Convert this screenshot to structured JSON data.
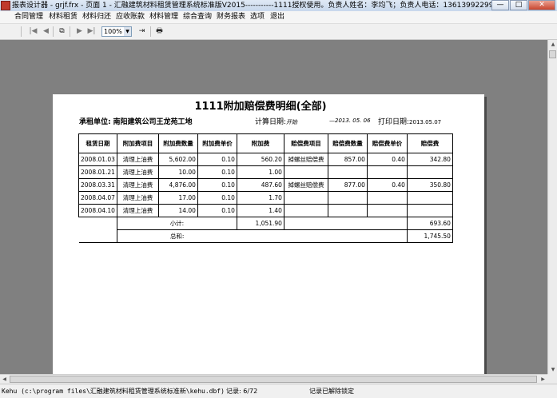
{
  "window": {
    "title": "报表设计器 - grjf.frx - 页面 1 - 汇融建筑材料租赁管理系统标准版V2015-----------1111授权使用。负责人姓名：李均飞；负责人电话：13613992299。",
    "minimize": "—",
    "maximize": "□",
    "close": "✕"
  },
  "menu": [
    "合同管理",
    "材料租赁",
    "材料归还",
    "应收账款",
    "材料管理",
    "综合查询",
    "财务报表",
    "选项",
    "退出"
  ],
  "toolbar": {
    "zoom": "100%",
    "icons": [
      "first-page-icon",
      "prev-page-icon",
      "copy-pages-icon",
      "next-page-icon",
      "last-page-icon",
      "zoom-select",
      "goto-icon",
      "print-icon"
    ]
  },
  "report": {
    "title": "1111附加赔偿费明细(全部)",
    "tenant_label": "承租单位:",
    "tenant": "南阳建筑公司王龙苑工地",
    "calc_label": "计算日期:",
    "calc_from": "开始",
    "calc_to": "—2013. 05. 06",
    "print_label": "打印日期:",
    "print_date": "2013.05.07",
    "headers": [
      "租赁日期",
      "附加费项目",
      "附加费数量",
      "附加费单价",
      "附加费",
      "赔偿费项目",
      "赔偿费数量",
      "赔偿费单价",
      "赔偿费"
    ],
    "rows": [
      [
        "2008.01.03",
        "清理上油费",
        "5,602.00",
        "0.10",
        "560.20",
        "掉螺丝赔偿费",
        "857.00",
        "0.40",
        "342.80"
      ],
      [
        "2008.01.21",
        "清理上油费",
        "10.00",
        "0.10",
        "1.00",
        "",
        "",
        "",
        ""
      ],
      [
        "2008.03.31",
        "清理上油费",
        "4,876.00",
        "0.10",
        "487.60",
        "掉螺丝赔偿费",
        "877.00",
        "0.40",
        "350.80"
      ],
      [
        "2008.04.07",
        "清理上油费",
        "17.00",
        "0.10",
        "1.70",
        "",
        "",
        "",
        ""
      ],
      [
        "2008.04.10",
        "清理上油费",
        "14.00",
        "0.10",
        "1.40",
        "",
        "",
        "",
        ""
      ]
    ],
    "subtotal_label": "小计:",
    "subtotal_fee": "1,051.90",
    "subtotal_comp": "693.60",
    "total_label": "总和:",
    "total": "1,745.50"
  },
  "status": {
    "db_path": "Kehu (c:\\program files\\汇融建筑材料租赁管理系统标准新\\kehu.dbf)",
    "record": "记录: 6/72",
    "lock": "记录已解除锁定"
  }
}
